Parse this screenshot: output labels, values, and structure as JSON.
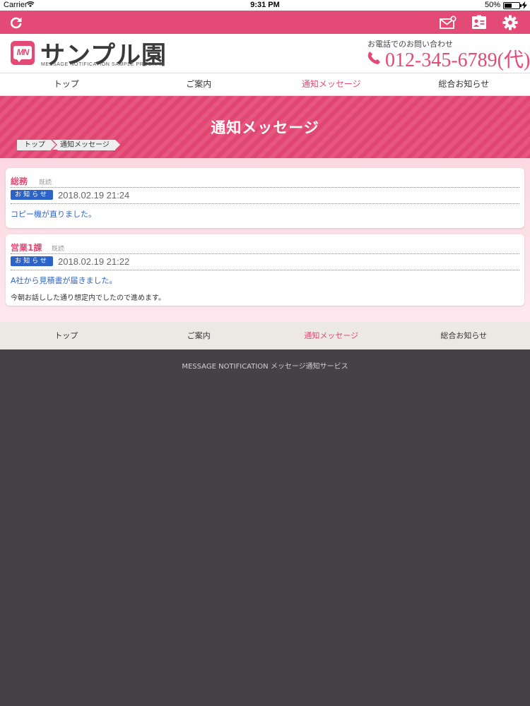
{
  "status_bar": {
    "carrier": "Carrier",
    "time": "9:31 PM",
    "battery": "50%",
    "battery_level": 0.5
  },
  "app_bar": {
    "icons": [
      "refresh-icon",
      "mail-notify-icon",
      "contact-card-icon",
      "gear-icon"
    ]
  },
  "header": {
    "logo_badge": "MN",
    "title": "サンプル園",
    "subtitle": "MESSAGE NOTIFICATION SAMPLE PROGRAM",
    "contact_label": "お電話でのお問い合わせ",
    "phone": "012-345-6789(代)"
  },
  "nav": {
    "items": [
      {
        "label": "トップ"
      },
      {
        "label": "ご案内"
      },
      {
        "label": "通知メッセージ"
      },
      {
        "label": "総合お知らせ"
      }
    ],
    "active_index": 2
  },
  "hero": {
    "title": "通知メッセージ",
    "breadcrumb": [
      "トップ",
      "通知メッセージ"
    ]
  },
  "messages": [
    {
      "sender": "総務",
      "read_status": "既読",
      "tag": "お知らせ",
      "date": "2018.02.19 21:24",
      "subject": "コピー機が直りました。",
      "body": ""
    },
    {
      "sender": "営業1課",
      "read_status": "既読",
      "tag": "お知らせ",
      "date": "2018.02.19 21:22",
      "subject": "A社から見積書が届きました。",
      "body": "今朝お話しした通り想定内でしたので進めます。"
    }
  ],
  "footer_nav": {
    "items": [
      {
        "label": "トップ"
      },
      {
        "label": "ご案内"
      },
      {
        "label": "通知メッセージ"
      },
      {
        "label": "総合お知らせ"
      }
    ],
    "active_index": 2
  },
  "footer": {
    "copyright": "MESSAGE NOTIFICATION  メッセージ通知サービス"
  },
  "colors": {
    "accent": "#e34a76",
    "tag_blue": "#2d63c8",
    "footer_bg": "#444244"
  }
}
